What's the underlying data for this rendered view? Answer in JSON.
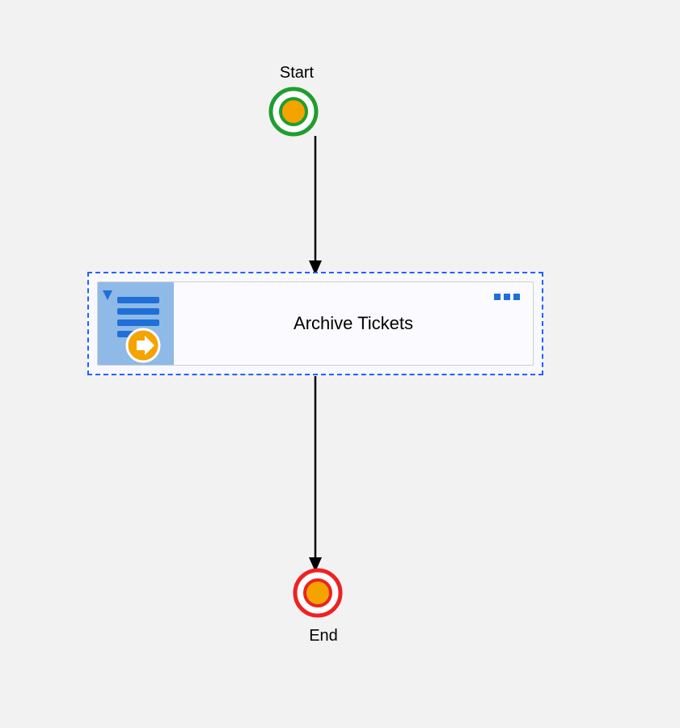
{
  "flow": {
    "start_label": "Start",
    "end_label": "End",
    "task_title": "Archive Tickets"
  }
}
